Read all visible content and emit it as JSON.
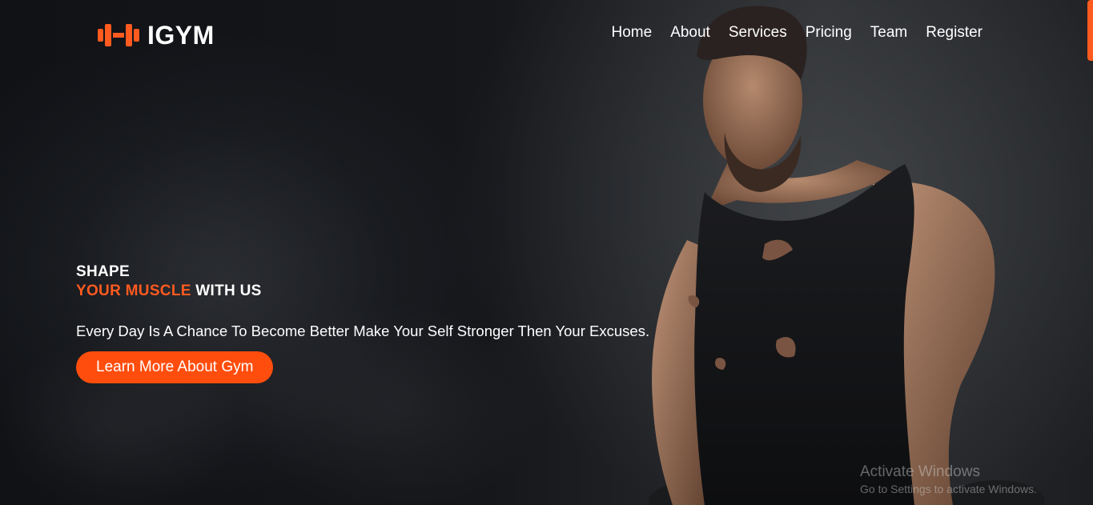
{
  "brand": {
    "name": "IGYM",
    "logo_icon": "dumbbell-icon",
    "accent_color": "#ff5a1f"
  },
  "nav": {
    "items": [
      {
        "label": "Home"
      },
      {
        "label": "About"
      },
      {
        "label": "Services"
      },
      {
        "label": "Pricing"
      },
      {
        "label": "Team"
      },
      {
        "label": "Register"
      }
    ]
  },
  "hero": {
    "line1": "SHAPE",
    "highlight": "YOUR MUSCLE",
    "line2_rest": " WITH US",
    "tagline": "Every Day Is A Chance To Become Better Make Your Self Stronger Then Your Excuses.",
    "cta_label": "Learn More About Gym",
    "cta_color": "#ff4d0d"
  },
  "watermark": {
    "title": "Activate Windows",
    "subtitle": "Go to Settings to activate Windows."
  }
}
